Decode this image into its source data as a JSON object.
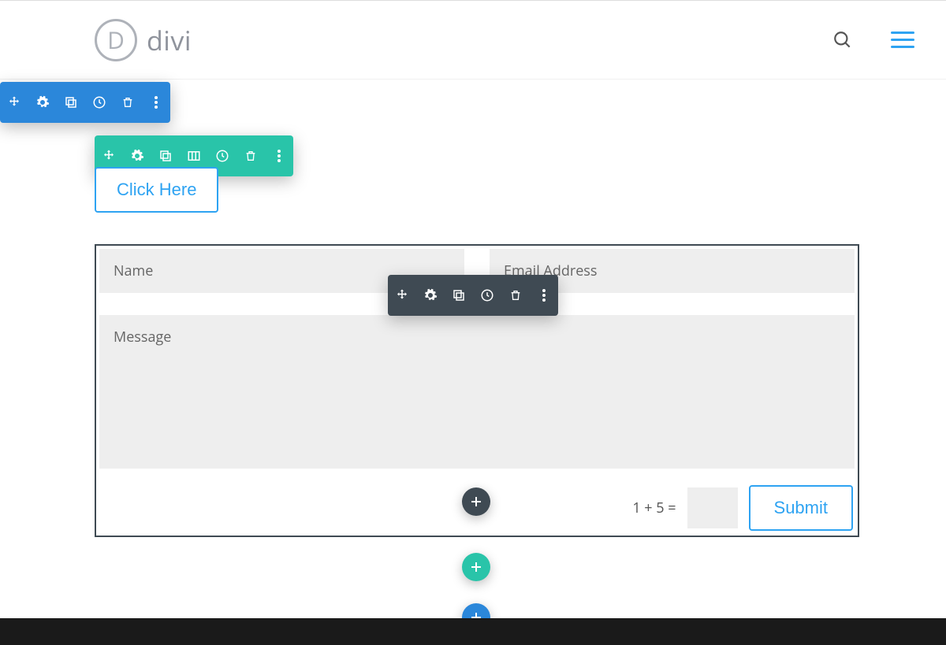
{
  "brand": {
    "mark_letter": "D",
    "name": "divi"
  },
  "button": {
    "click_here": "Click Here"
  },
  "form": {
    "name_placeholder": "Name",
    "email_placeholder": "Email Address",
    "message_placeholder": "Message",
    "captcha": "1 + 5 =",
    "submit": "Submit"
  },
  "colors": {
    "accent": "#2ea3f2",
    "section_blue": "#2b87da",
    "row_green": "#29c4a9",
    "module_dark": "#3f4a53"
  }
}
